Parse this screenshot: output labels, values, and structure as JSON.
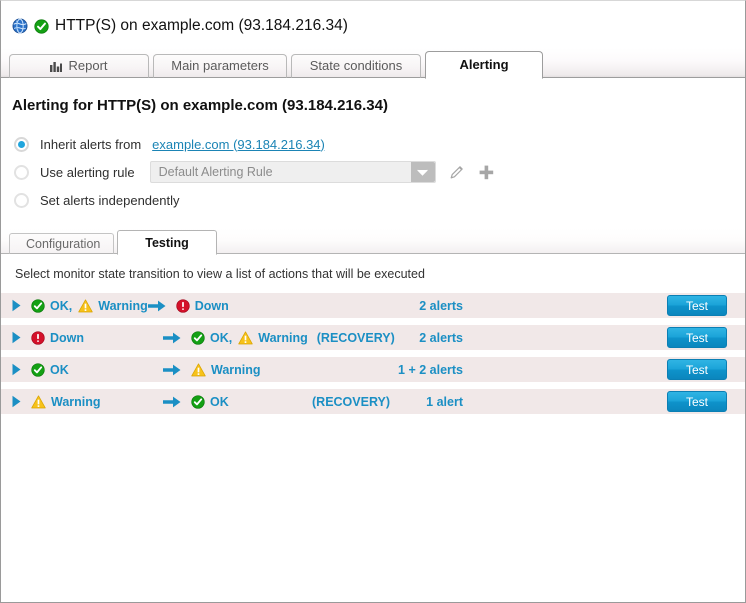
{
  "window": {
    "icon": "globe-icon",
    "status_icon": "ok-check-icon",
    "title": "HTTP(S) on example.com (93.184.216.34)"
  },
  "tabs": [
    {
      "label": "Report",
      "icon": "chart-bar-icon",
      "active": false
    },
    {
      "label": "Main parameters",
      "icon": "",
      "active": false
    },
    {
      "label": "State conditions",
      "icon": "",
      "active": false
    },
    {
      "label": "Alerting",
      "icon": "",
      "active": true
    }
  ],
  "page": {
    "title": "Alerting for HTTP(S) on example.com (93.184.216.34)"
  },
  "alert_source": {
    "options": [
      {
        "label": "Inherit alerts from",
        "selected": true,
        "link": "example.com (93.184.216.34)"
      },
      {
        "label": "Use alerting rule",
        "selected": false,
        "select_value": "Default Alerting Rule",
        "edit_icon": "pencil-icon",
        "add_icon": "plus-icon"
      },
      {
        "label": "Set alerts independently",
        "selected": false
      }
    ]
  },
  "inner_tabs": [
    {
      "label": "Configuration",
      "active": false
    },
    {
      "label": "Testing",
      "active": true
    }
  ],
  "testing": {
    "hint": "Select monitor state transition to view a list of actions that will be executed",
    "test_button_label": "Test",
    "recovery_label": "(RECOVERY)",
    "rows": [
      {
        "expander": "expand-triangle-icon",
        "from": [
          {
            "icon": "ok-check-icon",
            "label": "OK,"
          },
          {
            "icon": "warning-triangle-icon",
            "label": "Warning"
          }
        ],
        "arrow": "arrow-right-icon",
        "to": [
          {
            "icon": "down-error-icon",
            "label": "Down"
          }
        ],
        "recovery": "",
        "alerts": "2 alerts",
        "from_fixed": false
      },
      {
        "expander": "expand-triangle-icon",
        "from": [
          {
            "icon": "down-error-icon",
            "label": "Down"
          }
        ],
        "arrow": "arrow-right-icon",
        "to": [
          {
            "icon": "ok-check-icon",
            "label": "OK,"
          },
          {
            "icon": "warning-triangle-icon",
            "label": "Warning"
          }
        ],
        "recovery": "(RECOVERY)",
        "alerts": "2 alerts",
        "from_fixed": true
      },
      {
        "expander": "expand-triangle-icon",
        "from": [
          {
            "icon": "ok-check-icon",
            "label": "OK"
          }
        ],
        "arrow": "arrow-right-icon",
        "to": [
          {
            "icon": "warning-triangle-icon",
            "label": "Warning"
          }
        ],
        "recovery": "",
        "alerts": "1 + 2 alerts",
        "from_fixed": true
      },
      {
        "expander": "expand-triangle-icon",
        "from": [
          {
            "icon": "warning-triangle-icon",
            "label": "Warning"
          }
        ],
        "arrow": "arrow-right-icon",
        "to": [
          {
            "icon": "ok-check-icon",
            "label": "OK"
          }
        ],
        "recovery": "(RECOVERY)",
        "alerts": "1 alert",
        "from_fixed": true
      }
    ]
  },
  "colors": {
    "accent": "#1b8fc4",
    "ok": "#12a012",
    "warning": "#f7c21a",
    "down": "#d4112a",
    "row_bg": "#f1e8e8",
    "link": "#1b84b5"
  }
}
